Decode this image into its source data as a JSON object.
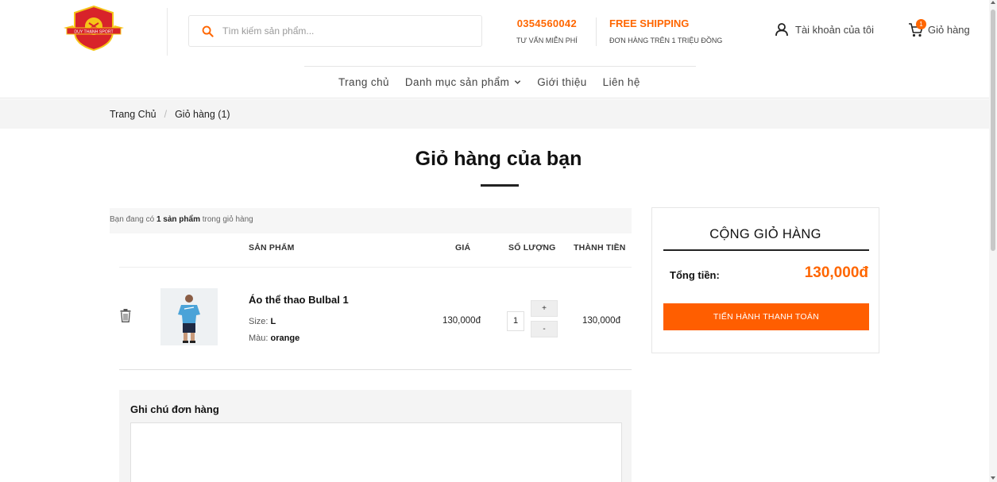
{
  "header": {
    "logo_icon": "shield-logo",
    "logo_text": "DUY THANH SPORT",
    "search": {
      "placeholder": "Tìm kiếm sản phẩm...",
      "value": "",
      "icon": "search-icon"
    },
    "hotline": {
      "number": "0354560042",
      "caption": "TƯ VẤN MIỄN PHÍ"
    },
    "shipping": {
      "title": "FREE SHIPPING",
      "caption": "ĐƠN HÀNG TRÊN 1 TRIỆU ĐỒNG"
    },
    "account": {
      "label": "Tài khoản của tôi",
      "icon": "user-icon"
    },
    "cart": {
      "label": "Giỏ hàng",
      "count": "1",
      "icon": "cart-icon"
    }
  },
  "nav": {
    "items": [
      {
        "label": "Trang chủ"
      },
      {
        "label": "Danh mục sản phẩm",
        "icon": "chevron-down-icon"
      },
      {
        "label": "Giới thiệu"
      },
      {
        "label": "Liên hệ"
      }
    ]
  },
  "breadcrumb": {
    "home": "Trang Chủ",
    "separator": "/",
    "current": "Giỏ hàng (1)"
  },
  "page": {
    "title": "Giỏ hàng của bạn"
  },
  "cart_table": {
    "info_prefix": "Bạn đang có ",
    "info_count": "1 sản phẩm",
    "info_suffix": " trong giỏ hàng",
    "headers": {
      "product": "SẢN PHẨM",
      "price": "GIÁ",
      "quantity": "SỐ LƯỢNG",
      "subtotal": "THÀNH TIỀN"
    },
    "items": [
      {
        "name": "Áo thể thao Bulbal 1",
        "size_label": "Size: ",
        "size": "L",
        "color_label": "Màu: ",
        "color": "orange",
        "price": "130,000đ",
        "quantity": "1",
        "plus": "+",
        "minus": "-",
        "subtotal": "130,000đ"
      }
    ]
  },
  "summary": {
    "title": "CỘNG GIỎ HÀNG",
    "total_label": "Tổng tiền:",
    "total_value": "130,000đ",
    "checkout_label": "TIẾN HÀNH THANH TOÁN"
  },
  "note": {
    "label": "Ghi chú đơn hàng",
    "value": ""
  },
  "colors": {
    "accent": "#ff6600",
    "button": "#ff5e00",
    "logo_red": "#d8232a",
    "logo_gold": "#f5c518"
  }
}
